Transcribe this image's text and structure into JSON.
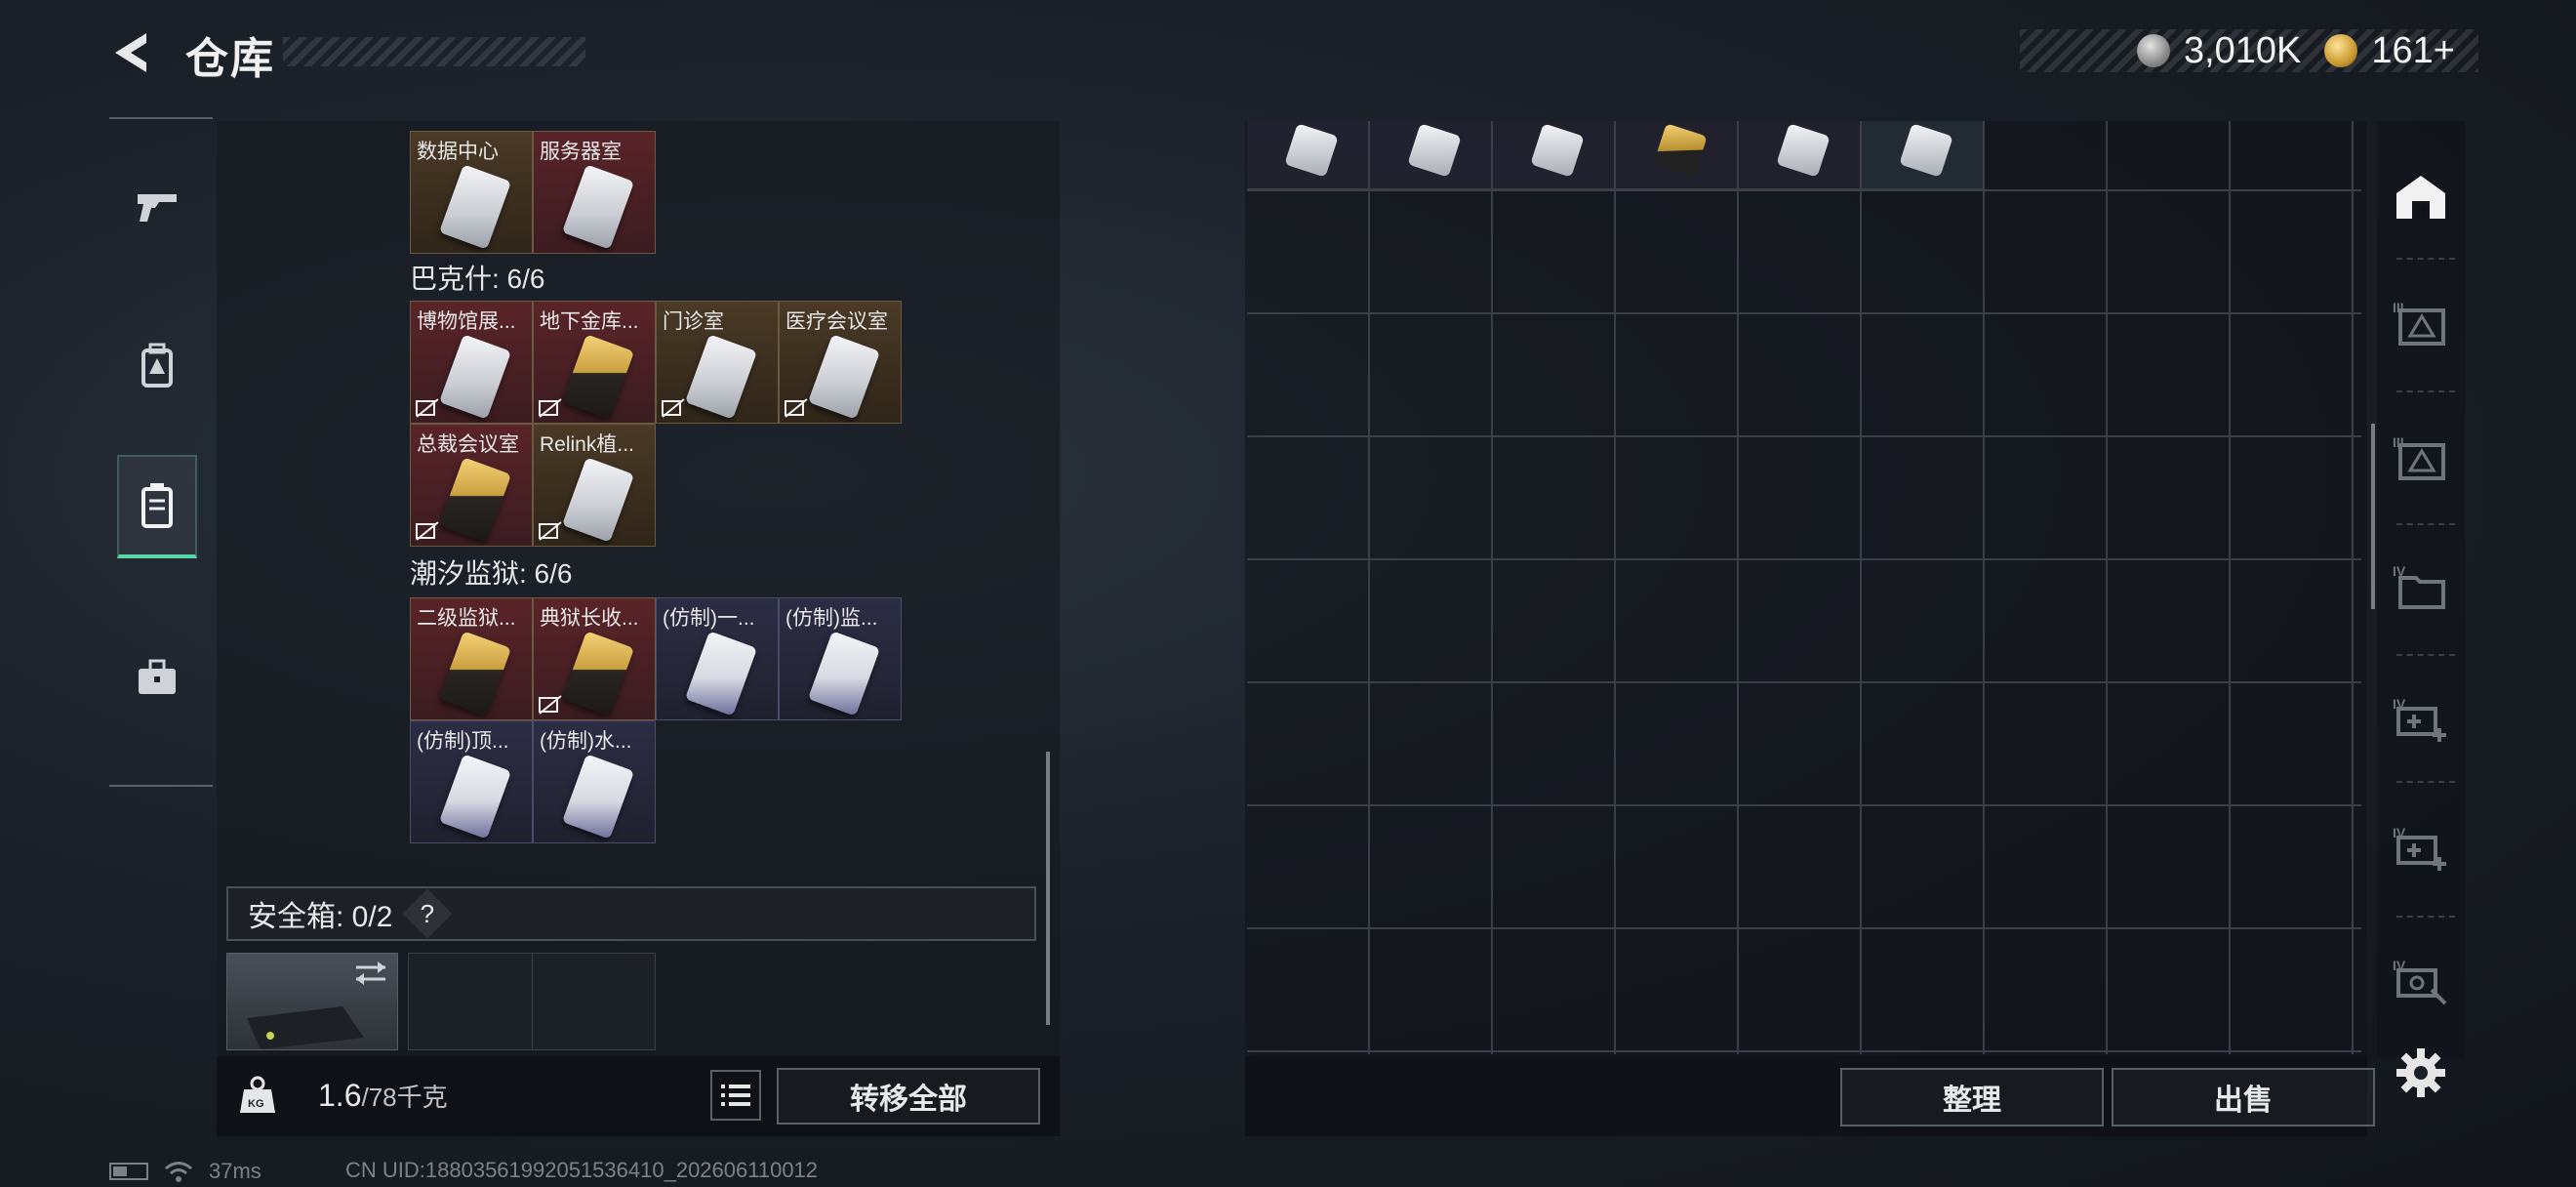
{
  "header": {
    "title": "仓库",
    "currency": [
      {
        "icon": "silver-coin-icon",
        "value": "3,010K"
      },
      {
        "icon": "gold-coin-icon",
        "value": "161+"
      }
    ]
  },
  "left_nav": [
    {
      "name": "weapons",
      "icon": "pistol-icon",
      "active": false
    },
    {
      "name": "gear",
      "icon": "backpack-icon",
      "active": false
    },
    {
      "name": "keys",
      "icon": "keycard-case-icon",
      "active": true
    },
    {
      "name": "medical",
      "icon": "toolbox-icon",
      "active": false
    }
  ],
  "stash": {
    "top_row": [
      {
        "label": "数据中心",
        "color": "gold",
        "card": "silver"
      },
      {
        "label": "服务器室",
        "color": "red",
        "card": "silver"
      }
    ],
    "sections": [
      {
        "title": "巴克什: 6/6",
        "rows": [
          [
            {
              "label": "博物馆展...",
              "color": "red",
              "card": "silver",
              "bound": true
            },
            {
              "label": "地下金库...",
              "color": "red",
              "card": "goldcard",
              "bound": true
            },
            {
              "label": "门诊室",
              "color": "gold",
              "card": "silver",
              "bound": true
            },
            {
              "label": "医疗会议室",
              "color": "gold",
              "card": "silver",
              "bound": true
            }
          ],
          [
            {
              "label": "总裁会议室",
              "color": "red",
              "card": "goldcard",
              "bound": true
            },
            {
              "label": "Relink植...",
              "color": "gold",
              "card": "silver",
              "bound": true
            }
          ]
        ]
      },
      {
        "title": "潮汐监狱: 6/6",
        "rows": [
          [
            {
              "label": "二级监狱...",
              "color": "red",
              "card": "goldcard",
              "bound": false
            },
            {
              "label": "典狱长收...",
              "color": "red",
              "card": "goldcard",
              "bound": true
            },
            {
              "label": "(仿制)一...",
              "color": "purple",
              "card": "purplecard",
              "bound": false
            },
            {
              "label": "(仿制)监...",
              "color": "purple",
              "card": "purplecard",
              "bound": false
            }
          ],
          [
            {
              "label": "(仿制)顶...",
              "color": "purple",
              "card": "purplecard",
              "bound": false
            },
            {
              "label": "(仿制)水...",
              "color": "purple",
              "card": "purplecard",
              "bound": false
            }
          ]
        ]
      }
    ]
  },
  "safebox": {
    "label": "安全箱: 0/2",
    "help": "?"
  },
  "bottom_left": {
    "weight_value": "1.6",
    "weight_total": "/78千克",
    "transfer_all": "转移全部"
  },
  "right_grid": {
    "top_items": [
      "silver",
      "silver",
      "silver",
      "gold",
      "silver",
      "silver"
    ]
  },
  "bottom_right": {
    "organize": "整理",
    "sell": "出售"
  },
  "right_tools": [
    {
      "name": "stash-home",
      "icon": "stash-home-icon",
      "roman": ""
    },
    {
      "name": "container-iii-a",
      "icon": "map-warning-icon",
      "roman": "III"
    },
    {
      "name": "container-iii-b",
      "icon": "map-warning-icon",
      "roman": "III"
    },
    {
      "name": "container-iv-folder",
      "icon": "folder-icon",
      "roman": "IV"
    },
    {
      "name": "container-iv-medkit-a",
      "icon": "medkit-plus-icon",
      "roman": "IV"
    },
    {
      "name": "container-iv-medkit-b",
      "icon": "medkit-plus-icon",
      "roman": "IV"
    },
    {
      "name": "container-iv-tools",
      "icon": "tools-icon",
      "roman": "IV"
    }
  ],
  "footer": {
    "ping": "37ms",
    "uid": "CN UID:1880356199205153641​0_202606110012"
  }
}
